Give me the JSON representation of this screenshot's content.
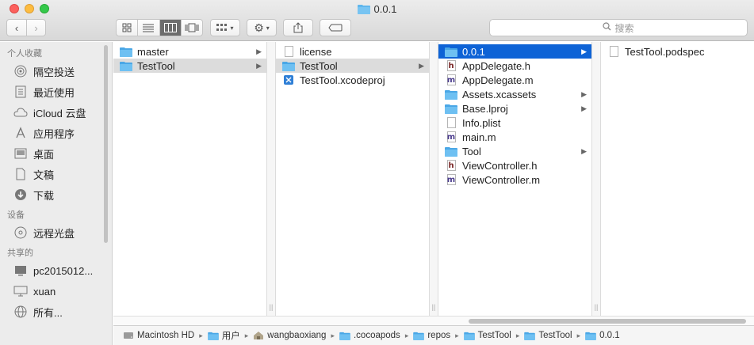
{
  "window": {
    "title": "0.0.1"
  },
  "toolbar": {
    "back_icon": "chevron-left-icon",
    "forward_icon": "chevron-right-icon",
    "search_placeholder": "搜索"
  },
  "sidebar": {
    "sections": [
      {
        "title": "个人收藏",
        "items": [
          {
            "label": "隔空投送",
            "icon": "airdrop-icon"
          },
          {
            "label": "最近使用",
            "icon": "recents-icon"
          },
          {
            "label": "iCloud 云盘",
            "icon": "cloud-icon"
          },
          {
            "label": "应用程序",
            "icon": "applications-icon"
          },
          {
            "label": "桌面",
            "icon": "desktop-icon"
          },
          {
            "label": "文稿",
            "icon": "documents-icon"
          },
          {
            "label": "下载",
            "icon": "download-icon"
          }
        ]
      },
      {
        "title": "设备",
        "items": [
          {
            "label": "远程光盘",
            "icon": "disc-icon"
          }
        ]
      },
      {
        "title": "共享的",
        "items": [
          {
            "label": "pc2015012...",
            "icon": "pc-icon"
          },
          {
            "label": "xuan",
            "icon": "display-icon"
          },
          {
            "label": "所有...",
            "icon": "globe-icon"
          }
        ]
      }
    ]
  },
  "columns": {
    "col1": [
      {
        "label": "master",
        "type": "folder",
        "has_children": true,
        "selected": ""
      },
      {
        "label": "TestTool",
        "type": "folder",
        "has_children": true,
        "selected": "grey"
      }
    ],
    "col2": [
      {
        "label": "license",
        "type": "file",
        "has_children": false,
        "selected": ""
      },
      {
        "label": "TestTool",
        "type": "folder",
        "has_children": true,
        "selected": "grey"
      },
      {
        "label": "TestTool.xcodeproj",
        "type": "xcodeproj",
        "has_children": false,
        "selected": ""
      }
    ],
    "col3": [
      {
        "label": "0.0.1",
        "type": "folder",
        "has_children": true,
        "selected": "blue"
      },
      {
        "label": "AppDelegate.h",
        "type": "h",
        "has_children": false,
        "selected": ""
      },
      {
        "label": "AppDelegate.m",
        "type": "m",
        "has_children": false,
        "selected": ""
      },
      {
        "label": "Assets.xcassets",
        "type": "folder",
        "has_children": true,
        "selected": ""
      },
      {
        "label": "Base.lproj",
        "type": "folder",
        "has_children": true,
        "selected": ""
      },
      {
        "label": "Info.plist",
        "type": "file",
        "has_children": false,
        "selected": ""
      },
      {
        "label": "main.m",
        "type": "m",
        "has_children": false,
        "selected": ""
      },
      {
        "label": "Tool",
        "type": "folder",
        "has_children": true,
        "selected": ""
      },
      {
        "label": "ViewController.h",
        "type": "h",
        "has_children": false,
        "selected": ""
      },
      {
        "label": "ViewController.m",
        "type": "m",
        "has_children": false,
        "selected": ""
      }
    ],
    "col4": [
      {
        "label": "TestTool.podspec",
        "type": "file",
        "has_children": false,
        "selected": ""
      }
    ]
  },
  "pathbar": [
    {
      "label": "Macintosh HD",
      "icon": "harddisk-icon"
    },
    {
      "label": "用户",
      "icon": "folder-icon"
    },
    {
      "label": "wangbaoxiang",
      "icon": "home-icon"
    },
    {
      "label": ".cocoapods",
      "icon": "folder-icon"
    },
    {
      "label": "repos",
      "icon": "folder-icon"
    },
    {
      "label": "TestTool",
      "icon": "folder-icon"
    },
    {
      "label": "TestTool",
      "icon": "folder-icon"
    },
    {
      "label": "0.0.1",
      "icon": "folder-icon"
    }
  ],
  "colors": {
    "folder": "#5fb6ec",
    "selection_blue": "#0e63d6",
    "selection_grey": "#dcdcdc"
  }
}
